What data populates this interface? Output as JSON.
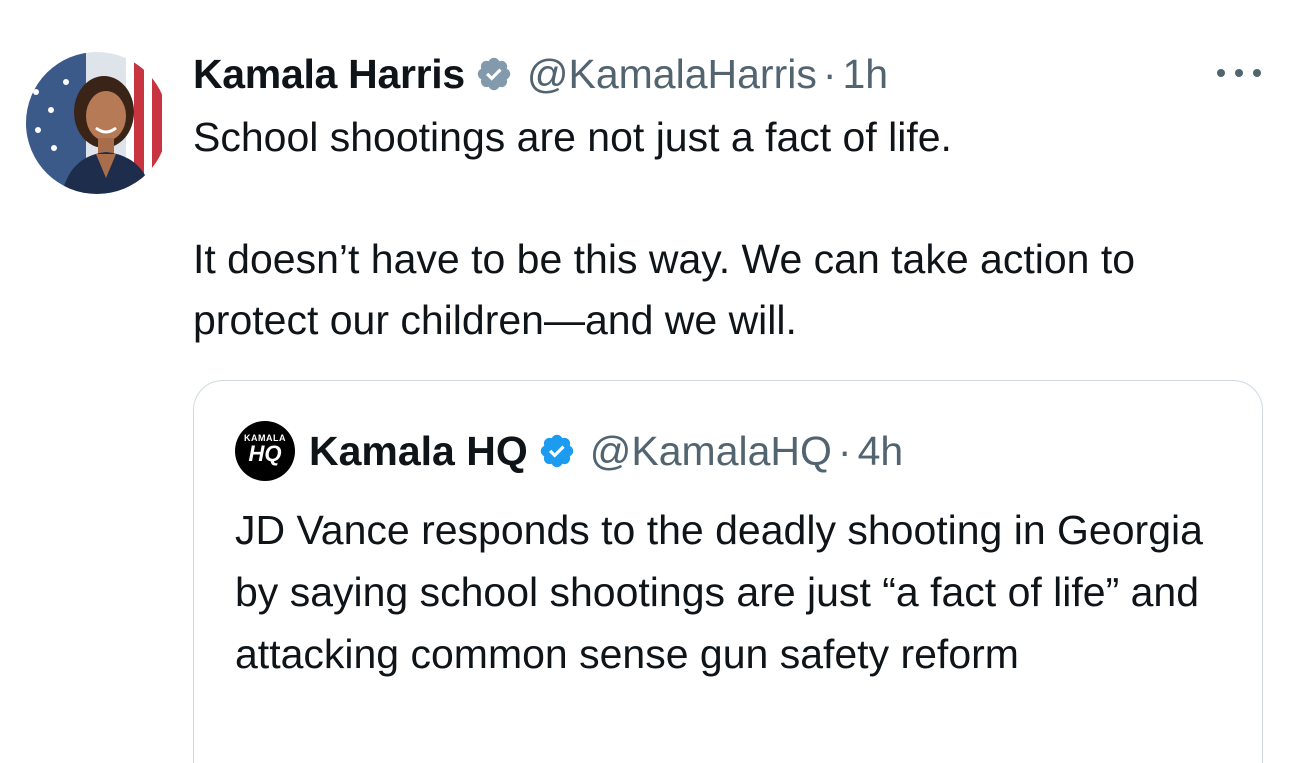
{
  "tweet": {
    "display_name": "Kamala Harris",
    "handle": "@KamalaHarris",
    "separator": "·",
    "time": "1h",
    "text_paragraphs": [
      "School shootings are not just a fact of life.",
      "It doesn’t have to be this way. We can take action to protect our children—and we will."
    ],
    "badge_color": "#829aab",
    "more_icon": "more-horizontal-icon"
  },
  "quote": {
    "avatar_small_text": "KAMALA",
    "avatar_big_text": "HQ",
    "display_name": "Kamala HQ",
    "handle": "@KamalaHQ",
    "separator": "·",
    "time": "4h",
    "badge_color": "#1d9bf0",
    "text": "JD Vance responds to the deadly shooting in Georgia by saying school shootings are just “a fact of life” and attacking common sense gun safety reform"
  }
}
